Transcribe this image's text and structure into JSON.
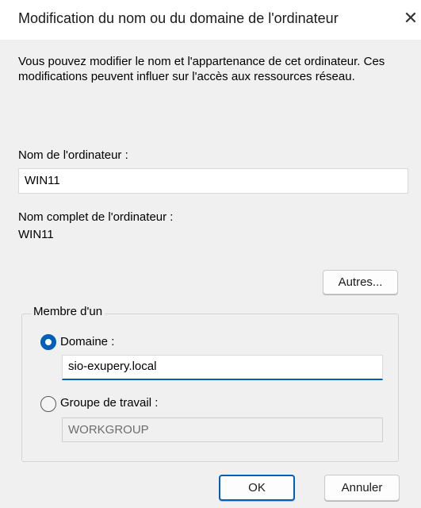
{
  "dialog": {
    "title": "Modification du nom ou du domaine de l'ordinateur",
    "close_symbol": "✕",
    "description": "Vous pouvez modifier le nom et l'appartenance de cet ordinateur. Ces modifications peuvent influer sur l'accès aux ressources réseau."
  },
  "computer_name": {
    "label": "Nom de l'ordinateur :",
    "value": "WIN11"
  },
  "full_name": {
    "label": "Nom complet de l'ordinateur :",
    "value": "WIN11"
  },
  "more_button": {
    "label": "Autres..."
  },
  "membership": {
    "legend": "Membre d'un",
    "domain": {
      "label": "Domaine :",
      "value": "sio-exupery.local",
      "selected": true
    },
    "workgroup": {
      "label": "Groupe de travail :",
      "value": "WORKGROUP",
      "selected": false,
      "disabled": true
    }
  },
  "buttons": {
    "ok": "OK",
    "cancel": "Annuler"
  },
  "colors": {
    "accent": "#005fb8",
    "background": "#f0f0f0",
    "titlebar": "#ffffff"
  }
}
